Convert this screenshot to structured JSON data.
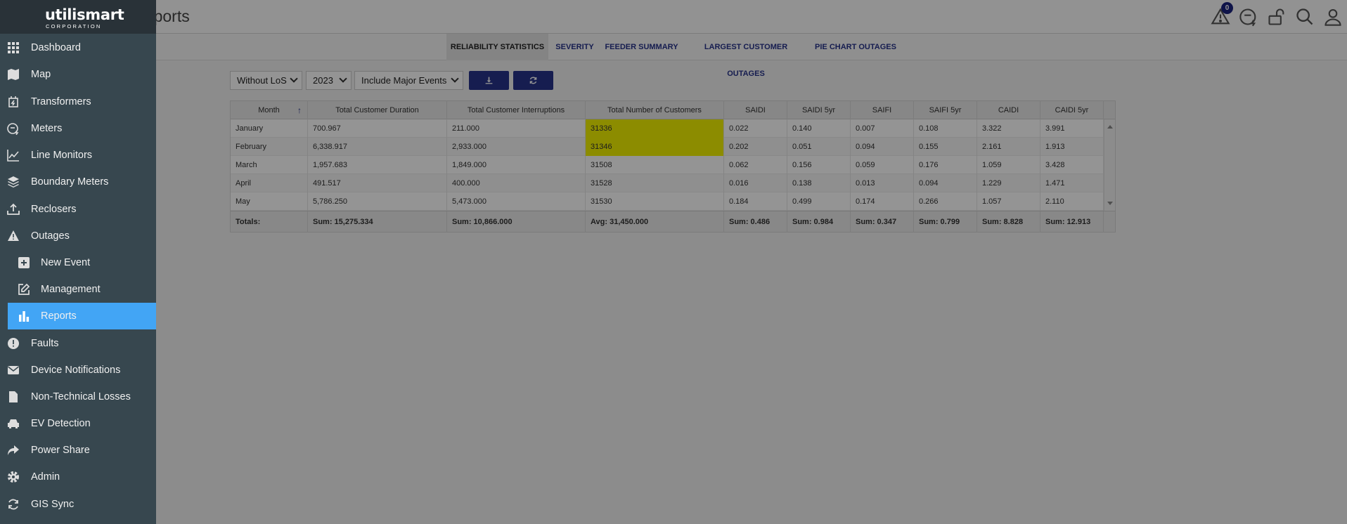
{
  "header": {
    "title": "e Reports",
    "alerts_count": "0"
  },
  "tabs": [
    {
      "label": "RELIABILITY STATISTICS",
      "active": true
    },
    {
      "label": "SEVERITY"
    },
    {
      "label": "FEEDER SUMMARY"
    },
    {
      "label": "LARGEST CUSTOMER OUTAGES"
    },
    {
      "label": "PIE CHART OUTAGES"
    }
  ],
  "controls": {
    "los_filter": "Without LoS",
    "year": "2023",
    "events_filter": "Include Major Events"
  },
  "table": {
    "columns": [
      "Month",
      "Total Customer Duration",
      "Total Customer Interruptions",
      "Total Number of Customers",
      "SAIDI",
      "SAIDI 5yr",
      "SAIFI",
      "SAIFI 5yr",
      "CAIDI",
      "CAIDI 5yr"
    ],
    "rows": [
      [
        "January",
        "700.967",
        "211.000",
        "31336",
        "0.022",
        "0.140",
        "0.007",
        "0.108",
        "3.322",
        "3.991"
      ],
      [
        "February",
        "6,338.917",
        "2,933.000",
        "31346",
        "0.202",
        "0.051",
        "0.094",
        "0.155",
        "2.161",
        "1.913"
      ],
      [
        "March",
        "1,957.683",
        "1,849.000",
        "31508",
        "0.062",
        "0.156",
        "0.059",
        "0.176",
        "1.059",
        "3.428"
      ],
      [
        "April",
        "491.517",
        "400.000",
        "31528",
        "0.016",
        "0.138",
        "0.013",
        "0.094",
        "1.229",
        "1.471"
      ],
      [
        "May",
        "5,786.250",
        "5,473.000",
        "31530",
        "0.184",
        "0.499",
        "0.174",
        "0.266",
        "1.057",
        "2.110"
      ]
    ],
    "totals": [
      "Totals:",
      "Sum: 15,275.334",
      "Sum: 10,866.000",
      "Avg: 31,450.000",
      "Sum: 0.486",
      "Sum: 0.984",
      "Sum: 0.347",
      "Sum: 0.799",
      "Sum: 8.828",
      "Sum: 12.913"
    ],
    "highlight_color": "#f2f200"
  },
  "sidebar": {
    "logo": "utilismart",
    "logo_sub": "CORPORATION",
    "items": [
      {
        "label": "Dashboard",
        "icon": "grid-icon"
      },
      {
        "label": "Map",
        "icon": "map-icon"
      },
      {
        "label": "Transformers",
        "icon": "transformer-icon"
      },
      {
        "label": "Meters",
        "icon": "meter-icon"
      },
      {
        "label": "Line Monitors",
        "icon": "line-chart-icon"
      },
      {
        "label": "Boundary Meters",
        "icon": "layers-icon"
      },
      {
        "label": "Reclosers",
        "icon": "upload-icon"
      },
      {
        "label": "Outages",
        "icon": "warning-icon"
      },
      {
        "label": "New Event",
        "icon": "plus-box-icon"
      },
      {
        "label": "Management",
        "icon": "edit-icon"
      },
      {
        "label": "Reports",
        "icon": "bar-chart-icon"
      },
      {
        "label": "Faults",
        "icon": "alert-circle-icon"
      },
      {
        "label": "Device Notifications",
        "icon": "envelope-icon"
      },
      {
        "label": "Non-Technical Losses",
        "icon": "file-icon"
      },
      {
        "label": "EV Detection",
        "icon": "car-icon"
      },
      {
        "label": "Power Share",
        "icon": "share-icon"
      },
      {
        "label": "Admin",
        "icon": "gear-icon"
      },
      {
        "label": "GIS Sync",
        "icon": "sync-icon"
      }
    ]
  },
  "colors": {
    "sidebar_bg": "#37474f",
    "active_item": "#42a5f5",
    "brand": "#27338a"
  }
}
